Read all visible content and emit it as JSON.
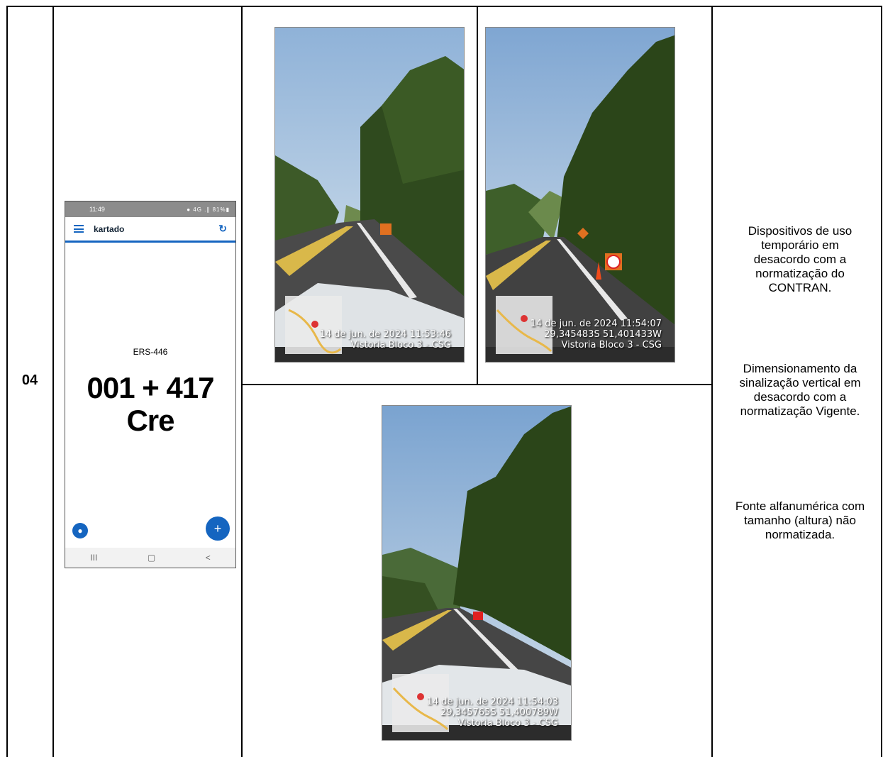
{
  "row": {
    "number": "04"
  },
  "phone": {
    "status_time": "11:49",
    "status_icons": "● 4G .∥ 81%▮",
    "app_title": "kartado",
    "road": "ERS-446",
    "km": "001 + 417",
    "direction": "Cre",
    "nav_recent": "III",
    "nav_home": "▢",
    "nav_back": "<"
  },
  "photos": [
    {
      "stamp_date": "14 de jun. de 2024 11:53:46",
      "stamp_coords": "",
      "stamp_label": "Vistoria Bloco 3 - CSG"
    },
    {
      "stamp_date": "14 de jun. de 2024 11:54:07",
      "stamp_coords": "29,345483S 51,401433W",
      "stamp_label": "Vistoria Bloco 3 - CSG"
    },
    {
      "stamp_date": "14 de jun. de 2024 11:54:03",
      "stamp_coords": "29,345765S 51,400789W",
      "stamp_label": "Vistoria Bloco 3 - CSG"
    }
  ],
  "observations": [
    "Dispositivos de uso temporário em desacordo com a normatização do CONTRAN.",
    "Dimensionamento da sinalização vertical em desacordo com a normatização Vigente.",
    "Fonte alfanumérica com tamanho (altura) não normatizada."
  ]
}
